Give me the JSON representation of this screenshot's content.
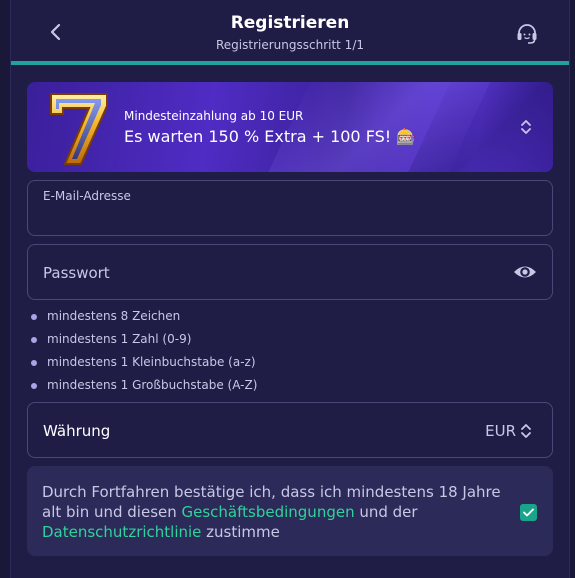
{
  "header": {
    "title": "Registrieren",
    "subtitle": "Registrierungsschritt 1/1",
    "back_icon": "chevron-left-icon",
    "support_icon": "headset-icon",
    "progress": 1.0,
    "progress_color": "#20a39a"
  },
  "banner": {
    "small_text": "Mindesteinzahlung ab 10 EUR",
    "big_text": "Es warten 150 % Extra + 100 FS! 🎰",
    "seven_glyph": "7",
    "chevron_icon": "chevron-up-down-icon"
  },
  "email": {
    "label": "E-Mail-Adresse",
    "value": ""
  },
  "password": {
    "placeholder": "Passwort",
    "eye_icon": "eye-icon"
  },
  "password_rules": [
    "mindestens 8 Zeichen",
    "mindestens 1 Zahl (0-9)",
    "mindestens 1 Kleinbuchstabe (a-z)",
    "mindestens 1 Großbuchstabe (A-Z)"
  ],
  "currency": {
    "label": "Währung",
    "value": "EUR",
    "chevron_icon": "chevron-up-down-icon"
  },
  "consent": {
    "text_before": "Durch Fortfahren bestätige ich, dass ich mindestens 18 Jahre alt bin und diesen ",
    "terms_link": "Geschäftsbedingungen",
    "text_middle": " und der ",
    "privacy_link": "Datenschutzrichtlinie",
    "text_after": " zustimme",
    "checked": true
  },
  "colors": {
    "background": "#1a1838",
    "panel": "#1f1d45",
    "accent_green": "#2fd39b",
    "checkbox": "#1aa58a"
  }
}
